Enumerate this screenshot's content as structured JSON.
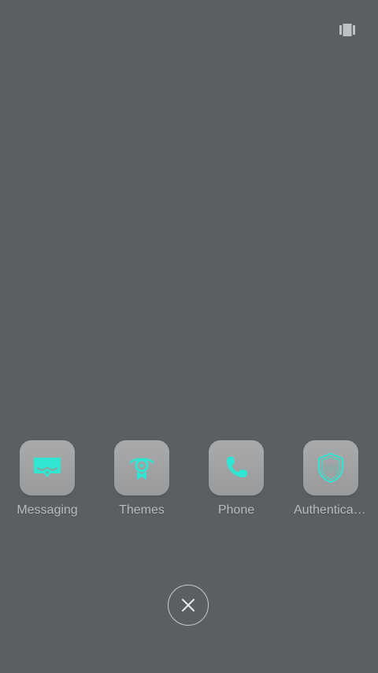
{
  "top_icon": "card-stack-icon",
  "apps": [
    {
      "label": "Messaging",
      "icon": "message-bubble-icon"
    },
    {
      "label": "Themes",
      "icon": "themes-ribbon-icon"
    },
    {
      "label": "Phone",
      "icon": "phone-handset-icon"
    },
    {
      "label": "Authenticat…",
      "icon": "shield-icon"
    }
  ],
  "close": {
    "icon": "close-icon"
  },
  "colors": {
    "background": "#5a5f62",
    "tile": "#a0a2a4",
    "accent": "#2ee6d2",
    "label": "#b9bcbe"
  }
}
